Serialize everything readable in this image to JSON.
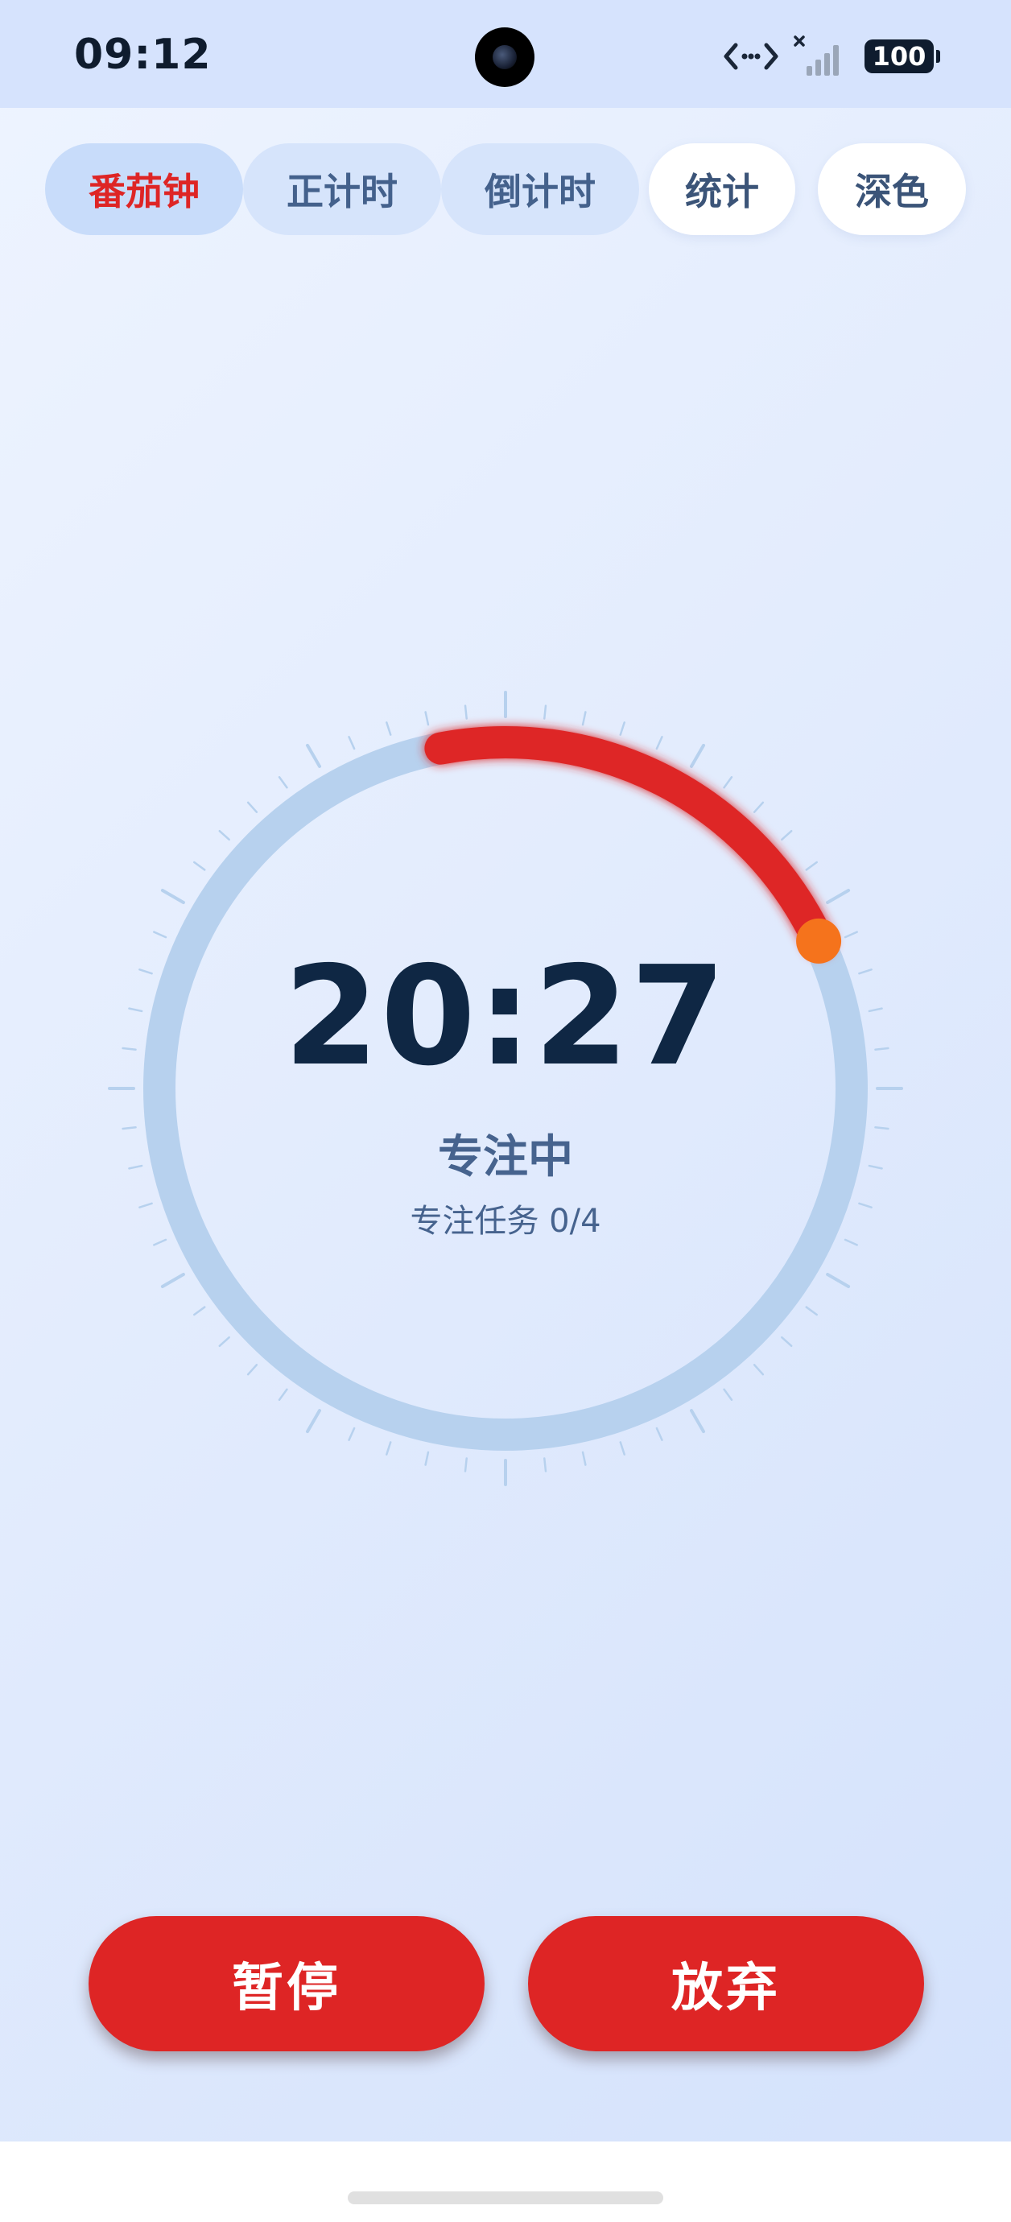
{
  "status_bar": {
    "time": "09:12",
    "battery": "100"
  },
  "tabs": [
    {
      "label": "番茄钟",
      "active": true
    },
    {
      "label": "正计时",
      "active": false
    },
    {
      "label": "倒计时",
      "active": false
    },
    {
      "label": "统计",
      "active": false
    },
    {
      "label": "深色",
      "active": false
    }
  ],
  "timer": {
    "remaining": "20:27",
    "state": "专注中",
    "task": "专注任务 0/4",
    "progress_fraction": 0.18
  },
  "actions": {
    "pause_label": "暂停",
    "abandon_label": "放弃"
  },
  "colors": {
    "accent_red": "#de2525",
    "knob_orange": "#f5731c",
    "track_blue": "#b7d1ee",
    "text_dark": "#0f2744"
  }
}
